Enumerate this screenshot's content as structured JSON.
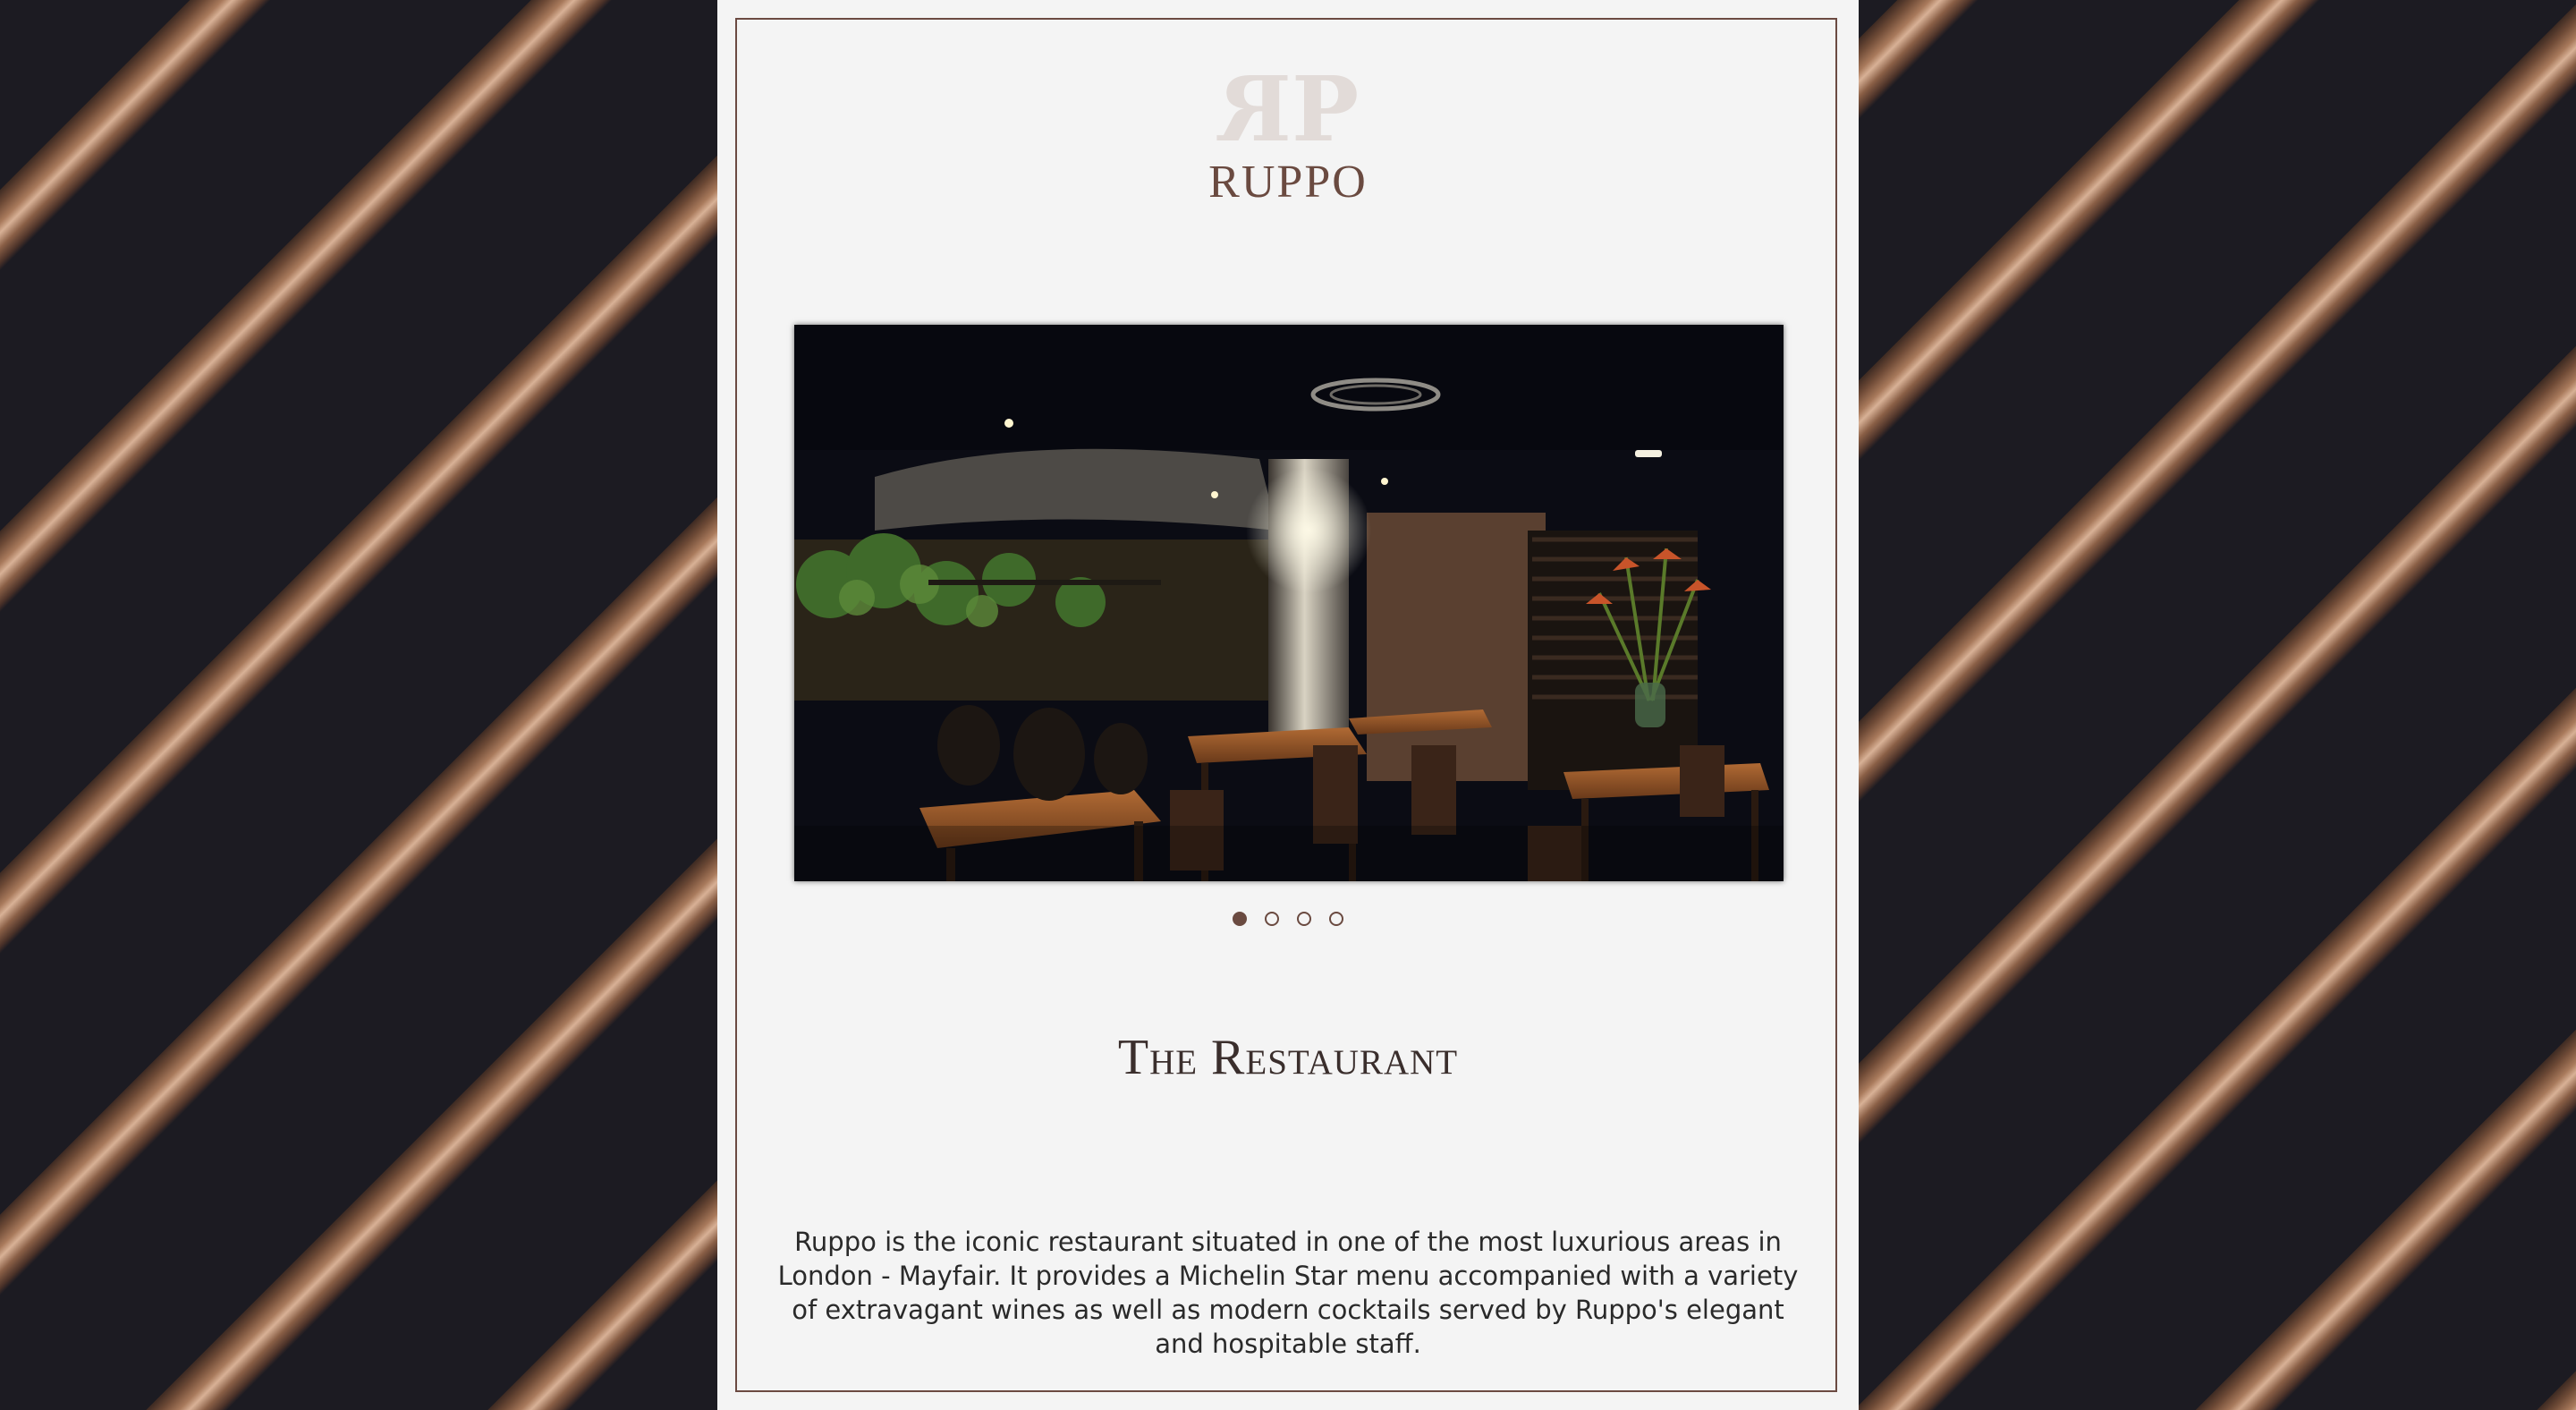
{
  "header": {
    "monogram_left": "R",
    "monogram_right": "P",
    "brand_name": "RUPPO"
  },
  "carousel": {
    "image_alt": "Dimly lit restaurant interior with wooden tables, chairs, hanging plants and a bar",
    "slide_count": 4,
    "active_index": 0
  },
  "section": {
    "title": "The Restaurant",
    "description": "Ruppo is the iconic restaurant situated in one of the most luxurious areas in London - Mayfair. It provides a Michelin Star menu accompanied with a variety of extravagant wines as well as modern cocktails served by Ruppo's elegant and hospitable staff."
  },
  "colors": {
    "accent": "#6a4a40",
    "panel_background": "#f4f4f4",
    "page_background": "#1c1b22",
    "wood_highlight": "#d8b196"
  }
}
